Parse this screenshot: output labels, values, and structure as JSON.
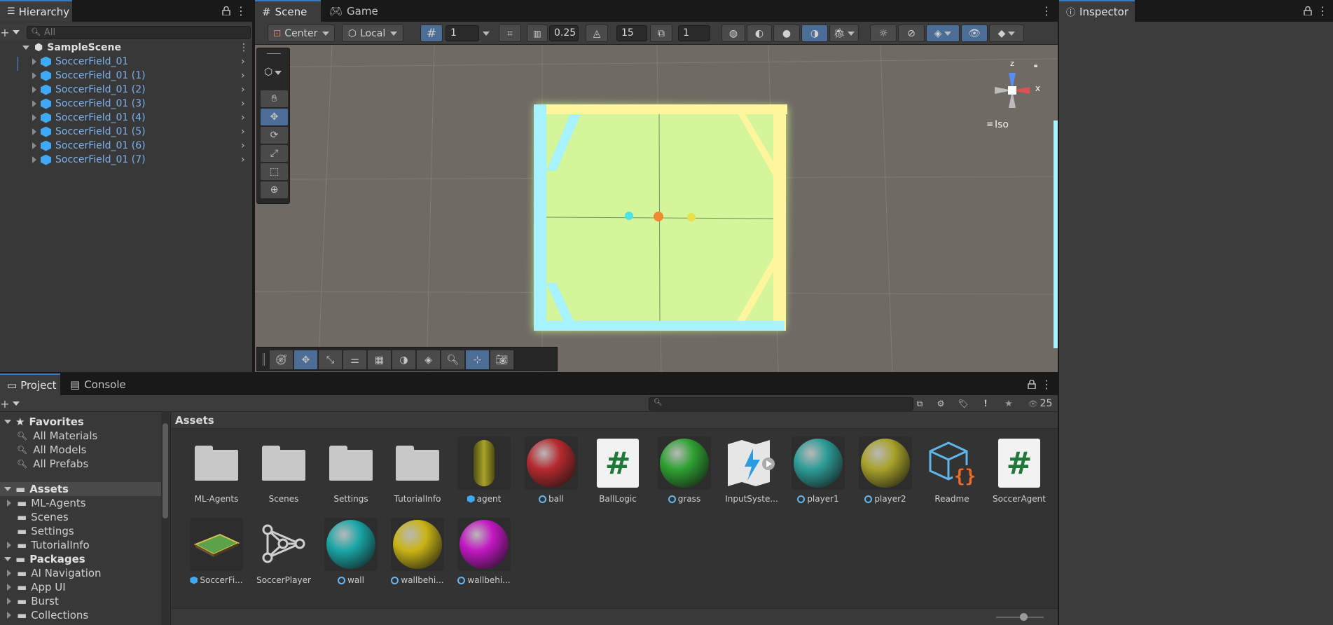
{
  "hierarchy": {
    "tab_label": "Hierarchy",
    "search_placeholder": "All",
    "scene_name": "SampleScene",
    "items": [
      {
        "label": "SoccerField_01"
      },
      {
        "label": "SoccerField_01 (1)"
      },
      {
        "label": "SoccerField_01 (2)"
      },
      {
        "label": "SoccerField_01 (3)"
      },
      {
        "label": "SoccerField_01 (4)"
      },
      {
        "label": "SoccerField_01 (5)"
      },
      {
        "label": "SoccerField_01 (6)"
      },
      {
        "label": "SoccerField_01 (7)"
      }
    ]
  },
  "scene_tabs": {
    "scene": "Scene",
    "game": "Game"
  },
  "scene_toolbar": {
    "pivot": "Center",
    "space": "Local",
    "grid_size": "1",
    "snap_increment": "0.25",
    "rotate_snap": "15",
    "scale_snap": "1"
  },
  "gizmo": {
    "x_label": "x",
    "z_label": "z",
    "projection": "Iso"
  },
  "inspector": {
    "tab_label": "Inspector"
  },
  "bottom_tabs": {
    "project": "Project",
    "console": "Console"
  },
  "project": {
    "visible_count": "25",
    "breadcrumb": "Assets",
    "favorites": {
      "title": "Favorites",
      "items": [
        "All Materials",
        "All Models",
        "All Prefabs"
      ]
    },
    "assets_root": "Assets",
    "assets_children": [
      "ML-Agents",
      "Scenes",
      "Settings",
      "TutorialInfo"
    ],
    "packages_root": "Packages",
    "packages_children": [
      "AI Navigation",
      "App UI",
      "Burst",
      "Collections"
    ],
    "grid": [
      {
        "label": "ML-Agents",
        "kind": "folder"
      },
      {
        "label": "Scenes",
        "kind": "folder"
      },
      {
        "label": "Settings",
        "kind": "folder"
      },
      {
        "label": "TutorialInfo",
        "kind": "folder"
      },
      {
        "label": "agent",
        "kind": "prefab"
      },
      {
        "label": "ball",
        "kind": "material",
        "color": "#b52a2e"
      },
      {
        "label": "BallLogic",
        "kind": "script"
      },
      {
        "label": "grass",
        "kind": "material",
        "color": "#2fa132"
      },
      {
        "label": "InputSyste...",
        "kind": "input"
      },
      {
        "label": "player1",
        "kind": "material",
        "color": "#2d9c97"
      },
      {
        "label": "player2",
        "kind": "material",
        "color": "#a8a22a"
      },
      {
        "label": "Readme",
        "kind": "readme"
      },
      {
        "label": "SoccerAgent",
        "kind": "script"
      },
      {
        "label": "SoccerFi...",
        "kind": "prefab-field"
      },
      {
        "label": "SoccerPlayer",
        "kind": "graph"
      },
      {
        "label": "wall",
        "kind": "material",
        "color": "#1aa6a6"
      },
      {
        "label": "wallbehi...",
        "kind": "material",
        "color": "#c9b416"
      },
      {
        "label": "wallbehi...",
        "kind": "material",
        "color": "#c217c2"
      }
    ]
  }
}
